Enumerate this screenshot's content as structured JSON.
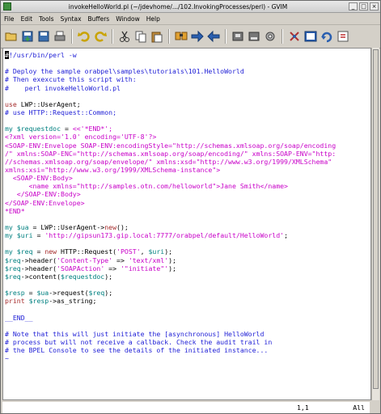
{
  "title": "invokeHelloWorld.pl (~/jdevhome/.../102.InvokingProcesses/perl) - GVIM",
  "menu": [
    "File",
    "Edit",
    "Tools",
    "Syntax",
    "Buffers",
    "Window",
    "Help"
  ],
  "toolbar_icons": [
    "open-icon",
    "save-icon",
    "save-all-icon",
    "print-icon",
    "undo-icon",
    "redo-icon",
    "cut-icon",
    "copy-icon",
    "paste-icon",
    "find-replace-icon",
    "find-next-icon",
    "find-prev-icon",
    "load-session-icon",
    "save-session-icon",
    "run-script-icon",
    "make-icon",
    "shell-icon",
    "ctags-icon",
    "help-icon",
    "find-help-icon"
  ],
  "code_lines": [
    [
      [
        "cursor",
        "#"
      ],
      [
        "comment",
        "!/usr/bin/perl -w"
      ]
    ],
    [],
    [
      [
        "comment",
        "# Deploy the sample orabpel\\samples\\tutorials\\101.HelloWorld"
      ]
    ],
    [
      [
        "comment",
        "# Then exexcute this script with:"
      ]
    ],
    [
      [
        "comment",
        "#    perl invokeHelloWorld.pl"
      ]
    ],
    [],
    [
      [
        "kw",
        "use"
      ],
      [
        "plain",
        " LWP::UserAgent;"
      ]
    ],
    [
      [
        "comment",
        "# use HTTP::Request::Common;"
      ]
    ],
    [],
    [
      [
        "var",
        "my $requestdoc"
      ],
      [
        "plain",
        " = "
      ],
      [
        "str",
        "<<'*END*';"
      ]
    ],
    [
      [
        "str",
        "<?xml version='1.0' encoding='UTF-8'?>"
      ]
    ],
    [
      [
        "tag",
        "<SOAP-ENV:Envelope SOAP-ENV:encodingStyle=\"http://schemas.xmlsoap.org/soap/encoding"
      ]
    ],
    [
      [
        "tag",
        "/\" xmlns:SOAP-ENC=\"http://schemas.xmlsoap.org/soap/encoding/\" xmlns:SOAP-ENV=\"http:"
      ]
    ],
    [
      [
        "tag",
        "//schemas.xmlsoap.org/soap/envelope/\" xmlns:xsd=\"http://www.w3.org/1999/XMLSchema\""
      ]
    ],
    [
      [
        "tag",
        "xmlns:xsi=\"http://www.w3.org/1999/XMLSchema-instance\">"
      ]
    ],
    [
      [
        "tag",
        "  <SOAP-ENV:Body>"
      ]
    ],
    [
      [
        "tag",
        "      <name xmlns=\"http://samples.otn.com/helloworld\">"
      ],
      [
        "str",
        "Jane Smith"
      ],
      [
        "tag",
        "</name>"
      ]
    ],
    [
      [
        "tag",
        "   </SOAP-ENV:Body>"
      ]
    ],
    [
      [
        "tag",
        "</SOAP-ENV:Envelope>"
      ]
    ],
    [
      [
        "str",
        "*END*"
      ]
    ],
    [],
    [
      [
        "var",
        "my $ua"
      ],
      [
        "plain",
        " = LWP::UserAgent->"
      ],
      [
        "kw",
        "new"
      ],
      [
        "plain",
        "();"
      ]
    ],
    [
      [
        "var",
        "my $uri"
      ],
      [
        "plain",
        " = "
      ],
      [
        "str",
        "'http://gipsun173.gip.local:7777/orabpel/default/HelloWorld'"
      ],
      [
        "plain",
        ";"
      ]
    ],
    [],
    [
      [
        "var",
        "my $req"
      ],
      [
        "plain",
        " = "
      ],
      [
        "kw",
        "new"
      ],
      [
        "plain",
        " HTTP::Request("
      ],
      [
        "str",
        "'POST'"
      ],
      [
        "plain",
        ", "
      ],
      [
        "var",
        "$uri"
      ],
      [
        "plain",
        ");"
      ]
    ],
    [
      [
        "var",
        "$req"
      ],
      [
        "plain",
        "->header("
      ],
      [
        "str",
        "'Content-Type'"
      ],
      [
        "plain",
        " => "
      ],
      [
        "str",
        "'text/xml'"
      ],
      [
        "plain",
        ");"
      ]
    ],
    [
      [
        "var",
        "$req"
      ],
      [
        "plain",
        "->header("
      ],
      [
        "str",
        "'SOAPAction'"
      ],
      [
        "plain",
        " => "
      ],
      [
        "str",
        "'\"initiate\"'"
      ],
      [
        "plain",
        ");"
      ]
    ],
    [
      [
        "var",
        "$req"
      ],
      [
        "plain",
        "->content("
      ],
      [
        "var",
        "$requestdoc"
      ],
      [
        "plain",
        ");"
      ]
    ],
    [],
    [
      [
        "var",
        "$resp"
      ],
      [
        "plain",
        " = "
      ],
      [
        "var",
        "$ua"
      ],
      [
        "plain",
        "->request("
      ],
      [
        "var",
        "$req"
      ],
      [
        "plain",
        ");"
      ]
    ],
    [
      [
        "kw",
        "print"
      ],
      [
        "plain",
        " "
      ],
      [
        "var",
        "$resp"
      ],
      [
        "plain",
        "->as_string;"
      ]
    ],
    [],
    [
      [
        "comment",
        "__END__"
      ]
    ],
    [],
    [
      [
        "comment",
        "# Note that this will just initiate the [asynchronous] HelloWorld"
      ]
    ],
    [
      [
        "comment",
        "# process but will not receive a callback. Check the audit trail in"
      ]
    ],
    [
      [
        "comment",
        "# the BPEL Console to see the details of the initiated instance..."
      ]
    ],
    [
      [
        "tilde",
        "~"
      ]
    ]
  ],
  "status": {
    "position": "1,1",
    "percent": "All"
  },
  "colors": {
    "comment": "#1e1ed6",
    "str": "#c800c8",
    "tag": "#c800c8",
    "var": "#008080",
    "kw": "#a52a2a",
    "plain": "#000000",
    "tilde": "#1e1ed6"
  }
}
